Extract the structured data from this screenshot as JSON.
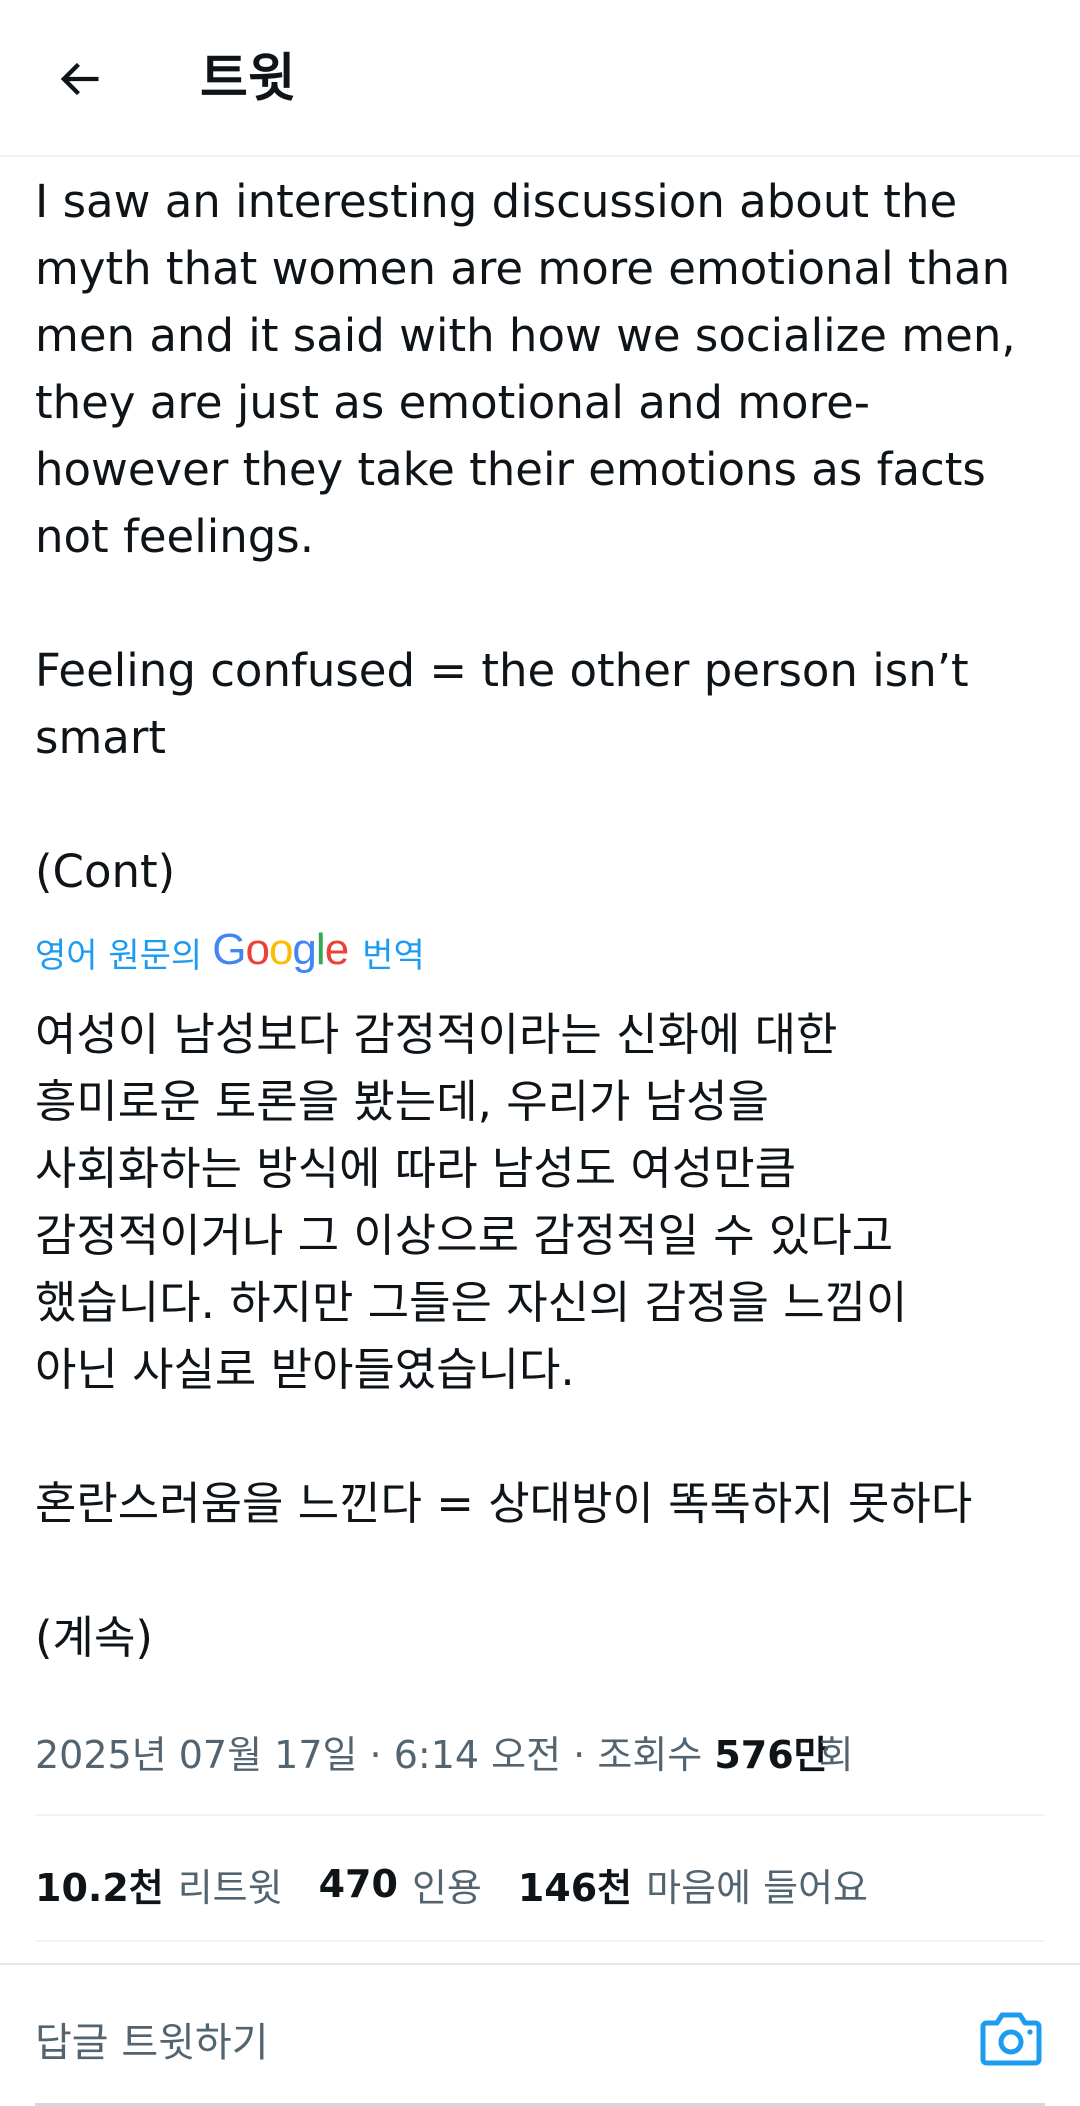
{
  "header": {
    "title": "트윗",
    "back_icon": "arrow-left-icon"
  },
  "tweet": {
    "paragraphs": [
      "I saw an interesting discussion about the myth that women are more emotional than men and it said with how we socialize men, they are just as emotional and more- however they take their emotions as facts not feelings.",
      "Feeling confused = the other person isn’t smart",
      "(Cont)"
    ],
    "translate": {
      "prefix": "영어 원문의",
      "brand_letters": [
        "G",
        "o",
        "o",
        "g",
        "l",
        "e"
      ],
      "brand_colors": [
        "#4285F4",
        "#EA4335",
        "#FBBC05",
        "#4285F4",
        "#34A853",
        "#EA4335"
      ],
      "suffix": "번역",
      "link_color": "#1d9bf0"
    },
    "translated_paragraphs": [
      "여성이 남성보다 감정적이라는 신화에 대한\n흥미로운 토론을 봤는데, 우리가 남성을\n사회화하는 방식에 따라 남성도 여성만큼\n감정적이거나 그 이상으로 감정적일 수 있다고\n했습니다. 하지만 그들은 자신의 감정을 느낌이\n아닌 사실로 받아들였습니다.",
      "혼란스러움을 느낀다 = 상대방이 똑똑하지 못하다",
      "(계속)"
    ],
    "meta": {
      "date": "2025년 07월 17일",
      "separator": "·",
      "time": "6:14 오전",
      "views_label": "조회수",
      "views_value": "576만",
      "views_suffix": "회"
    },
    "stats": [
      {
        "value": "10.2천",
        "label": "리트윗"
      },
      {
        "value": "470",
        "label": "인용"
      },
      {
        "value": "146천",
        "label": "마음에 들어요"
      }
    ]
  },
  "reply": {
    "placeholder": "답글 트윗하기",
    "camera_icon": "camera-icon",
    "accent_color": "#1d9bf0"
  }
}
